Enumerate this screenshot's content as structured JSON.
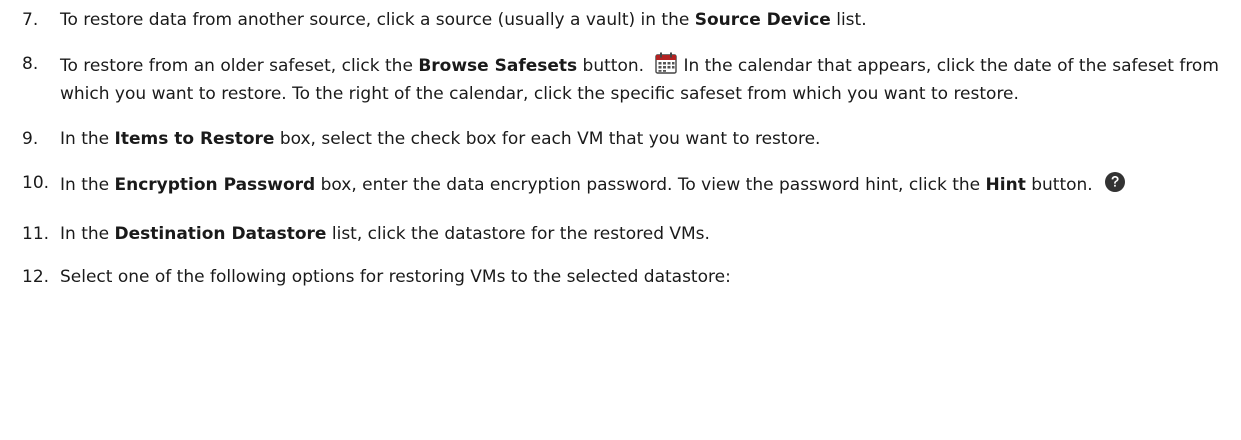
{
  "steps": [
    {
      "number": "7.",
      "parts": {
        "a": "To restore data from another source, click a source (usually a vault) in the ",
        "b_bold": "Source Device",
        "c": " list."
      }
    },
    {
      "number": "8.",
      "parts": {
        "a": "To restore from an older safeset, click the ",
        "b_bold": "Browse Safesets",
        "c": " button.",
        "icon": "calendar-icon",
        "d": "In the calendar that appears, click the date of the safeset from which you want to restore. To the right of the calendar, click the specific safeset from which you want to restore."
      }
    },
    {
      "number": "9.",
      "parts": {
        "a": "In the ",
        "b_bold": "Items to Restore",
        "c": " box, select the check box for each VM that you want to restore."
      }
    },
    {
      "number": "10.",
      "parts": {
        "a": "In the ",
        "b_bold": "Encryption Password",
        "c": " box, enter the data encryption password. To view the password hint, click the ",
        "d_bold": "Hint",
        "e": " button.",
        "icon": "question-circle-icon"
      }
    },
    {
      "number": "11.",
      "parts": {
        "a": "In the ",
        "b_bold": "Destination Datastore",
        "c": " list, click the datastore for the restored VMs."
      }
    },
    {
      "number": "12.",
      "parts": {
        "a": "Select one of the following options for restoring VMs to the selected datastore:"
      }
    }
  ],
  "colors": {
    "text": "#1a1a1a",
    "icon_dark": "#333333",
    "calendar_red": "#b22222"
  }
}
